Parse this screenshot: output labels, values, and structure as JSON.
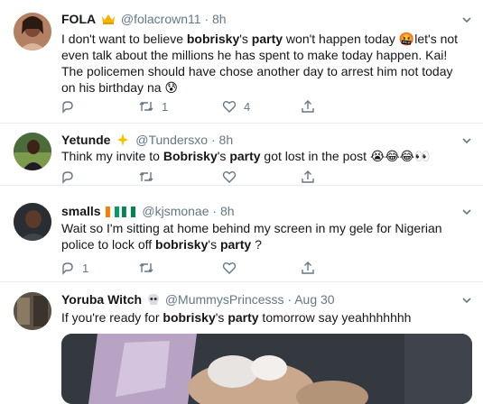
{
  "tweets": [
    {
      "name": "FOLA",
      "name_badge": "👑",
      "handle": "@folacrown11",
      "sep": "·",
      "time": "8h",
      "text": [
        "I don't want to believe ",
        "bobrisky",
        "'s ",
        "party",
        " won't happen today ",
        "🤬",
        "let's not even talk about the millions he has spent to make today happen. Kai! The policemen should have chose another day to arrest him not today on his birthday na ",
        "😰"
      ],
      "retweets": "1",
      "likes": "4"
    },
    {
      "name": "Yetunde",
      "name_badge": "✨",
      "handle": "@Tundersxo",
      "sep": "·",
      "time": "8h",
      "text": [
        "Think my invite to ",
        "Bobrisky",
        "'s ",
        "party",
        " got lost in the post ",
        "😭😂😂👀"
      ],
      "retweets": "",
      "likes": ""
    },
    {
      "name": "smalls",
      "name_badge": "🇨🇮🇳🇬",
      "handle": "@kjsmonae",
      "sep": "·",
      "time": "8h",
      "text": [
        "Wait so I'm sitting at home behind my screen in my gele for Nigerian police to lock off ",
        "bobrisky",
        "'s ",
        "party",
        " ?"
      ],
      "replies": "1",
      "retweets": "",
      "likes": ""
    },
    {
      "name": "Yoruba Witch",
      "name_badge": "💀",
      "handle": "@MummysPrincesss",
      "sep": "·",
      "time": "Aug 30",
      "text": [
        "If you're ready for ",
        "bobrisky",
        "'s ",
        "party",
        " tomorrow say yeahhhhhhh"
      ]
    }
  ],
  "colors": {
    "text": "#14171a",
    "meta": "#657786",
    "divider": "#e6ecf0",
    "crown": "#f5b400"
  },
  "icons": [
    "reply-icon",
    "retweet-icon",
    "like-icon",
    "share-icon",
    "chevron-down-icon"
  ]
}
